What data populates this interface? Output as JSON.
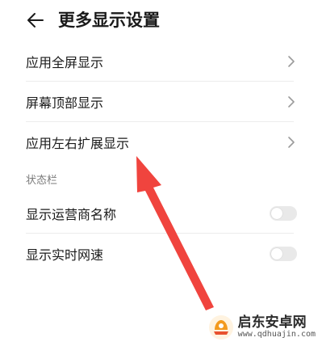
{
  "header": {
    "title": "更多显示设置",
    "back_icon": "arrow-left-icon"
  },
  "menu": [
    {
      "label": "应用全屏显示"
    },
    {
      "label": "屏幕顶部显示"
    },
    {
      "label": "应用左右扩展显示"
    }
  ],
  "status_bar_section": {
    "heading": "状态栏",
    "toggles": [
      {
        "label": "显示运营商名称",
        "on": false
      },
      {
        "label": "显示实时网速",
        "on": false
      }
    ]
  },
  "annotation": {
    "arrow_color": "#f0443e"
  },
  "watermark": {
    "name": "启东安卓网",
    "url": "www.qdhuajin.com"
  }
}
